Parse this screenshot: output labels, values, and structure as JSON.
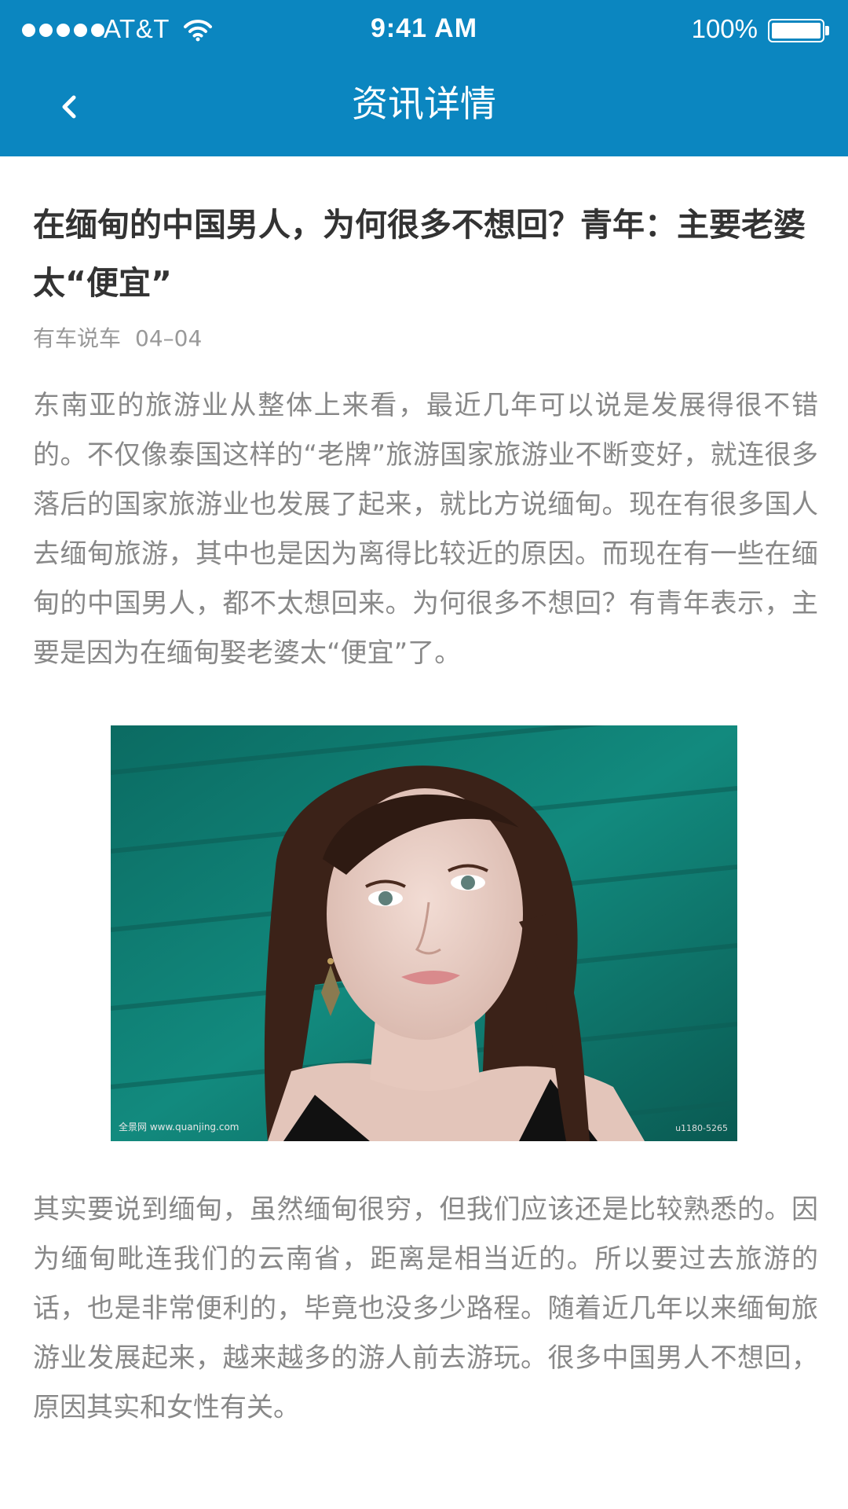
{
  "status_bar": {
    "carrier": "AT&T",
    "time": "9:41 AM",
    "battery": "100%"
  },
  "nav": {
    "title": "资讯详情",
    "back_icon": "chevron-left-icon"
  },
  "article": {
    "title": "在缅甸的中国男人，为何很多不想回？青年：主要老婆太“便宜”",
    "source": "有车说车",
    "date": "04–04",
    "paragraph_1": "东南亚的旅游业从整体上来看，最近几年可以说是发展得很不错的。不仅像泰国这样的“老牌”旅游国家旅游业不断变好，就连很多落后的国家旅游业也发展了起来，就比方说缅甸。现在有很多国人去缅甸旅游，其中也是因为离得比较近的原因。而现在有一些在缅甸的中国男人，都不太想回来。为何很多不想回？有青年表示，主要是因为在缅甸娶老婆太“便宜”了。",
    "image": {
      "watermark_left": "全景网 www.quanjing.com",
      "watermark_right": "u1180-5265"
    },
    "paragraph_2": "其实要说到缅甸，虽然缅甸很穷，但我们应该还是比较熟悉的。因为缅甸毗连我们的云南省，距离是相当近的。所以要过去旅游的话，也是非常便利的，毕竟也没多少路程。随着近几年以来缅甸旅游业发展起来，越来越多的游人前去游玩。很多中国男人不想回，原因其实和女性有关。"
  },
  "colors": {
    "header": "#0b86c0",
    "title_text": "#333333",
    "body_text": "#888888",
    "meta_text": "#999999"
  }
}
